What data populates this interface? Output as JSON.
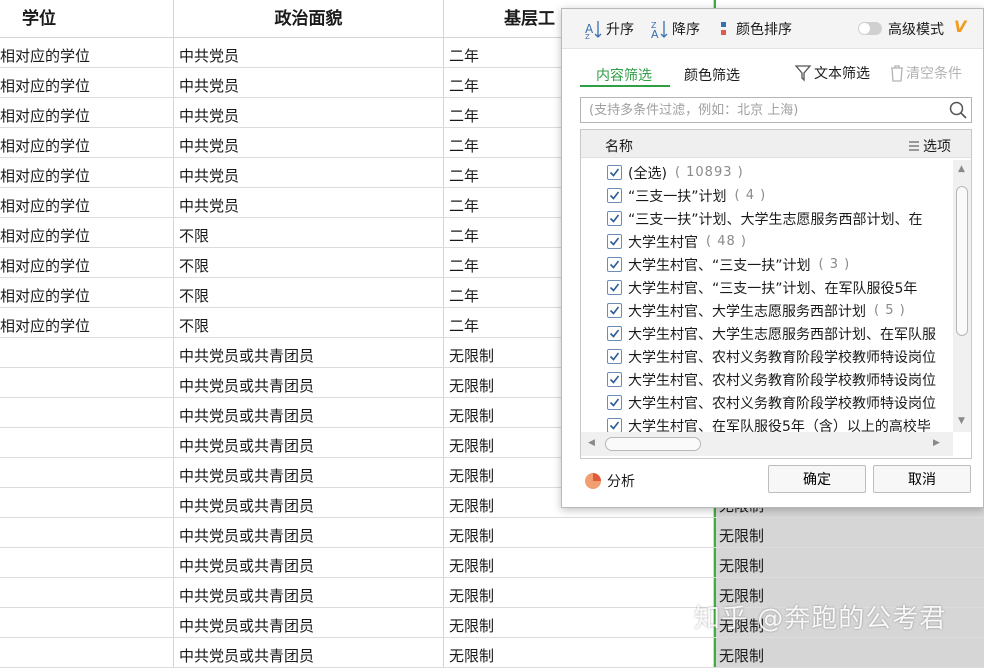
{
  "headers": [
    "学位",
    "政治面貌",
    "基层工",
    ""
  ],
  "rows": [
    [
      "相对应的学位",
      "中共党员",
      "二年",
      ""
    ],
    [
      "相对应的学位",
      "中共党员",
      "二年",
      ""
    ],
    [
      "相对应的学位",
      "中共党员",
      "二年",
      ""
    ],
    [
      "相对应的学位",
      "中共党员",
      "二年",
      ""
    ],
    [
      "相对应的学位",
      "中共党员",
      "二年",
      ""
    ],
    [
      "相对应的学位",
      "中共党员",
      "二年",
      ""
    ],
    [
      "相对应的学位",
      "不限",
      "二年",
      ""
    ],
    [
      "相对应的学位",
      "不限",
      "二年",
      ""
    ],
    [
      "相对应的学位",
      "不限",
      "二年",
      ""
    ],
    [
      "相对应的学位",
      "不限",
      "二年",
      ""
    ],
    [
      "",
      "中共党员或共青团员",
      "无限制",
      ""
    ],
    [
      "",
      "中共党员或共青团员",
      "无限制",
      ""
    ],
    [
      "",
      "中共党员或共青团员",
      "无限制",
      ""
    ],
    [
      "",
      "中共党员或共青团员",
      "无限制",
      ""
    ],
    [
      "",
      "中共党员或共青团员",
      "无限制",
      ""
    ],
    [
      "",
      "中共党员或共青团员",
      "无限制",
      "无限制"
    ],
    [
      "",
      "中共党员或共青团员",
      "无限制",
      "无限制"
    ],
    [
      "",
      "中共党员或共青团员",
      "无限制",
      "无限制"
    ],
    [
      "",
      "中共党员或共青团员",
      "无限制",
      "无限制"
    ],
    [
      "",
      "中共党员或共青团员",
      "无限制",
      "无限制"
    ],
    [
      "",
      "中共党员或共青团员",
      "无限制",
      "无限制"
    ]
  ],
  "watermark": "知乎 @奔跑的公考君",
  "popup": {
    "toolbar": {
      "asc": "升序",
      "desc": "降序",
      "color_sort": "颜色排序",
      "advanced_mode": "高级模式",
      "vip_badge": "V"
    },
    "tabs": {
      "content_filter": "内容筛选",
      "color_filter": "颜色筛选"
    },
    "text_filter": "文本筛选",
    "clear_conditions": "清空条件",
    "search_placeholder": "(支持多条件过滤，例如：北京 上海)",
    "list_header": {
      "name": "名称",
      "options": "选项"
    },
    "items": [
      {
        "label": "(全选)",
        "count": "( 10893 )"
      },
      {
        "label": "“三支一扶”计划",
        "count": "( 4 )"
      },
      {
        "label": "“三支一扶”计划、大学生志愿服务西部计划、在",
        "count": ""
      },
      {
        "label": "大学生村官",
        "count": "( 48 )"
      },
      {
        "label": "大学生村官、“三支一扶”计划",
        "count": "( 3 )"
      },
      {
        "label": "大学生村官、“三支一扶”计划、在军队服役5年",
        "count": ""
      },
      {
        "label": "大学生村官、大学生志愿服务西部计划",
        "count": "( 5 )"
      },
      {
        "label": "大学生村官、大学生志愿服务西部计划、在军队服",
        "count": ""
      },
      {
        "label": "大学生村官、农村义务教育阶段学校教师特设岗位",
        "count": ""
      },
      {
        "label": "大学生村官、农村义务教育阶段学校教师特设岗位",
        "count": ""
      },
      {
        "label": "大学生村官、农村义务教育阶段学校教师特设岗位",
        "count": ""
      },
      {
        "label": "大学生村官、在军队服役5年（含）以上的高校毕",
        "count": ""
      }
    ],
    "analyze": "分析",
    "ok": "确定",
    "cancel": "取消"
  },
  "colors": {
    "accent_green": "#2f9e44",
    "selection_border": "#3fae3f",
    "vip_orange": "#f29b1f"
  }
}
